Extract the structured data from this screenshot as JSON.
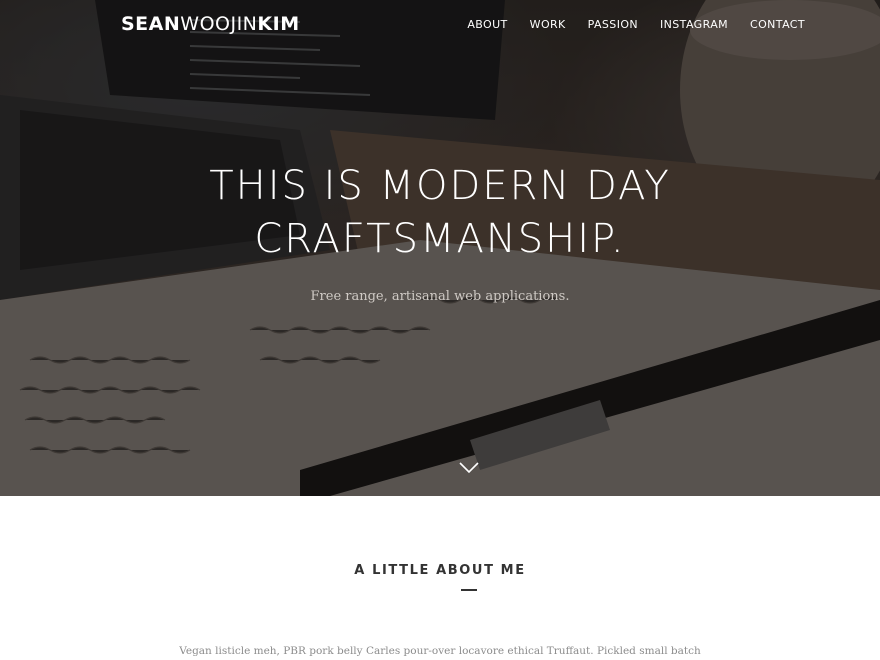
{
  "logo": {
    "bold_part": "SEAN",
    "light_part": "WOOJIN",
    "bold_part_2": "KIM"
  },
  "nav": {
    "items": [
      {
        "label": "ABOUT"
      },
      {
        "label": "WORK"
      },
      {
        "label": "PASSION"
      },
      {
        "label": "INSTAGRAM"
      },
      {
        "label": "CONTACT"
      }
    ]
  },
  "hero": {
    "headline_line1": "THIS IS MODERN DAY",
    "headline_line2": "CRAFTSMANSHIP.",
    "tagline": "Free range, artisanal web applications.",
    "scroll_icon": "chevron-down-icon"
  },
  "about": {
    "title": "A LITTLE ABOUT ME",
    "text": "Vegan listicle meh, PBR pork belly Carles pour-over locavore ethical Truffaut. Pickled small batch"
  },
  "colors": {
    "hero_overlay": "#1a1411",
    "text_light": "#ffffff",
    "heading_dark": "#333333",
    "body_gray": "#8c8c8c"
  }
}
